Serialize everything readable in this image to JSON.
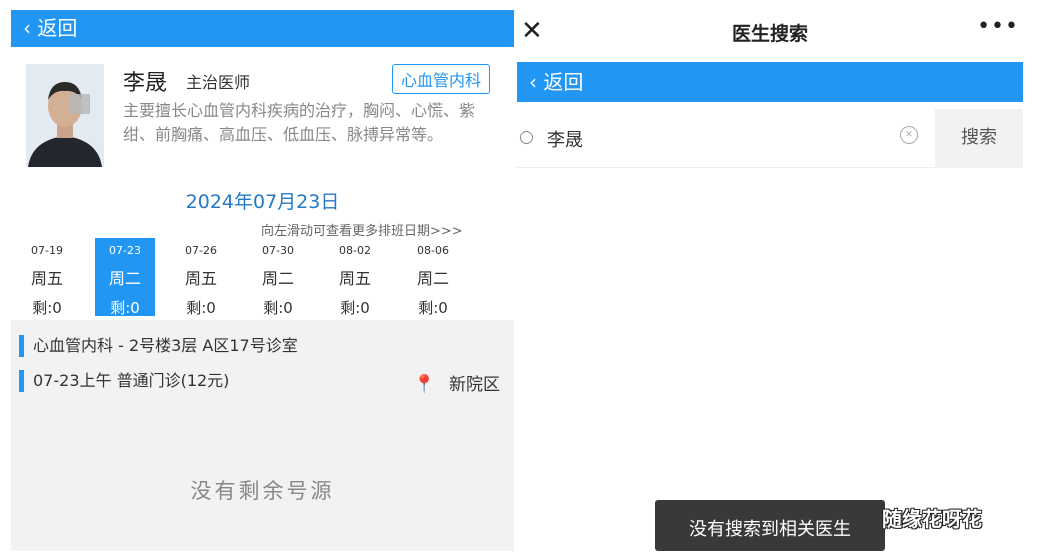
{
  "left": {
    "header": {
      "back_label": "‹ 返回"
    },
    "doctor": {
      "name": "李晟",
      "title": "主治医师",
      "department_tag": "心血管内科",
      "description": "主要擅长心血管内科疾病的治疗，胸闷、心慌、紫绀、前胸痛、高血压、低血压、脉搏异常等。"
    },
    "schedule": {
      "selected_date": "2024年07月23日",
      "swipe_hint": "向左滑动可查看更多排班日期>>>",
      "days": [
        {
          "date": "07-19",
          "weekday": "周五",
          "remaining": "剩:0",
          "selected": false
        },
        {
          "date": "07-23",
          "weekday": "周二",
          "remaining": "剩:0",
          "selected": true
        },
        {
          "date": "07-26",
          "weekday": "周五",
          "remaining": "剩:0",
          "selected": false
        },
        {
          "date": "07-30",
          "weekday": "周二",
          "remaining": "剩:0",
          "selected": false
        },
        {
          "date": "08-02",
          "weekday": "周五",
          "remaining": "剩:0",
          "selected": false
        },
        {
          "date": "08-06",
          "weekday": "周二",
          "remaining": "剩:0",
          "selected": false
        }
      ]
    },
    "info": {
      "location": "心血管内科 - 2号楼3层 A区17号诊室",
      "slot": "07-23上午   普通门诊(12元)",
      "campus": "新院区",
      "empty_message": "没有剩余号源"
    }
  },
  "right": {
    "topbar": {
      "close_label": "✕",
      "title": "医生搜索",
      "more_label": "•••"
    },
    "header": {
      "back_label": "‹ 返回"
    },
    "search": {
      "query": "李晟",
      "button_label": "搜索"
    },
    "toast": "没有搜索到相关医生"
  },
  "watermark": "随缘花呀花",
  "colors": {
    "accent": "#2196f3",
    "date_heading": "#2479c8"
  }
}
